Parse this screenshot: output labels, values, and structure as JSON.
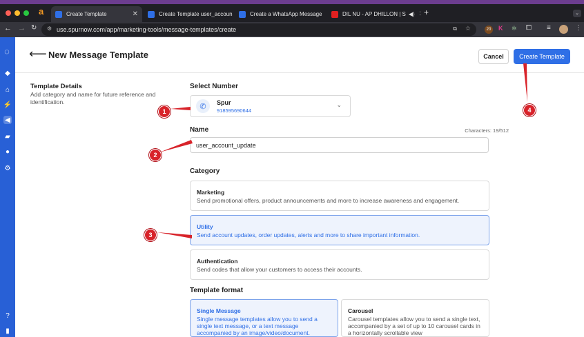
{
  "browser": {
    "tabs": [
      {
        "label": "Create Template",
        "color": "#2f6fe6"
      },
      {
        "label": "Create Template user_accoun",
        "color": "#2f6fe6"
      },
      {
        "label": "Create a WhatsApp Message",
        "color": "#2f6fe6"
      },
      {
        "label": "DIL NU - AP DHILLON | S",
        "color": "#e02020"
      }
    ],
    "url": "use.spurnow.com/app/marketing-tools/message-templates/create",
    "ext_badge": "20"
  },
  "header": {
    "title": "New Message Template",
    "cancel_label": "Cancel",
    "create_label": "Create Template"
  },
  "details": {
    "title": "Template Details",
    "description": "Add category and name for future reference and identification."
  },
  "number": {
    "section": "Select Number",
    "name": "Spur",
    "phone": "918595690644"
  },
  "name_field": {
    "label": "Name",
    "chars": "Characters: 19/512",
    "value": "user_account_update"
  },
  "category": {
    "section": "Category",
    "options": [
      {
        "title": "Marketing",
        "desc": "Send promotional offers, product announcements and more to increase awareness and engagement."
      },
      {
        "title": "Utility",
        "desc": "Send account updates, order updates, alerts and more to share important information."
      },
      {
        "title": "Authentication",
        "desc": "Send codes that allow your customers to access their accounts."
      }
    ]
  },
  "format": {
    "section": "Template format",
    "options": [
      {
        "title": "Single Message",
        "desc": "Single message templates allow you to send a single text message, or a text message accompanied by an image/video/document."
      },
      {
        "title": "Carousel",
        "desc": "Carousel templates allow you to send a single text, accompanied by a set of up to 10 carousel cards in a horizontally scrollable view"
      }
    ]
  },
  "annotations": [
    "1",
    "2",
    "3",
    "4"
  ],
  "colors": {
    "accent": "#2f6fe6",
    "sidebar": "#2860d6",
    "annotation": "#d8232a"
  }
}
